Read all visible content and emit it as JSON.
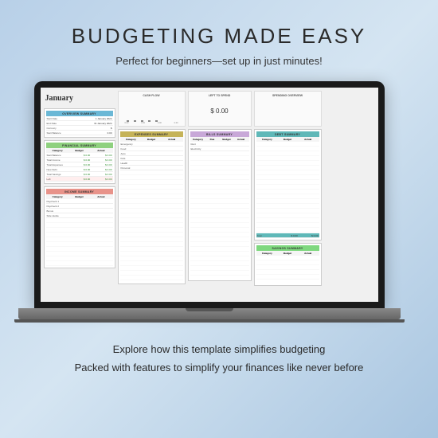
{
  "hero": {
    "title": "BUDGETING MADE EASY",
    "subtitle": "Perfect for beginners—set up in just minutes!"
  },
  "footer": {
    "line1": "Explore how this template simplifies budgeting",
    "line2": "Packed with features to simplify your finances like never before"
  },
  "sheet": {
    "month": "January",
    "overview": {
      "header": "OVERVIEW SUMMARY",
      "rows": [
        [
          "Start Date",
          "1 January 2024"
        ],
        [
          "End Date",
          "31 January 2024"
        ],
        [
          "Currency",
          "$"
        ],
        [
          "Start Balance",
          "0.00"
        ]
      ]
    },
    "financial": {
      "header": "FINANCIAL SUMMARY",
      "cols": [
        "Category",
        "Budget",
        "Actual"
      ],
      "rows": [
        [
          "Start Balance",
          "$ 0.00",
          "$ 0.00"
        ],
        [
          "Total Income",
          "$ 0.00",
          "$ 0.00"
        ],
        [
          "Total Expenses",
          "$ 0.00",
          "$ 0.00"
        ],
        [
          "New Debt",
          "$ 0.00",
          "$ 0.00"
        ],
        [
          "Total Savings",
          "$ 0.00",
          "$ 0.00"
        ]
      ],
      "left": [
        "Left",
        "$ 0.00",
        "$ 0.00"
      ]
    },
    "income": {
      "header": "INCOME SUMMARY",
      "cols": [
        "Category",
        "Budget",
        "Actual"
      ],
      "rows": [
        [
          "Paycheck 1",
          "",
          ""
        ],
        [
          "Paycheck 2",
          "",
          ""
        ],
        [
          "Bonus",
          "",
          ""
        ],
        [
          "Side Hustle",
          "",
          ""
        ]
      ]
    },
    "cashflow": {
      "title": "CASH FLOW",
      "axis": [
        "0.00",
        "0.00",
        "0.00",
        "0.00"
      ],
      "labels": [
        "Income",
        "Expenses",
        "Bills",
        "Debt",
        "Savings"
      ]
    },
    "lefttospend": {
      "title": "LEFT TO SPEND",
      "value": "$ 0.00"
    },
    "spending": {
      "title": "SPENDING OVERVIEW"
    },
    "expenses": {
      "header": "EXPENSES SUMMARY",
      "cols": [
        "Category",
        "Budget",
        "Actual"
      ],
      "rows": [
        [
          "Emergency",
          "",
          ""
        ],
        [
          "Food",
          "",
          ""
        ],
        [
          "Auto",
          "",
          ""
        ],
        [
          "Kids",
          "",
          ""
        ],
        [
          "Health",
          "",
          ""
        ],
        [
          "Personal",
          "",
          ""
        ]
      ]
    },
    "bills": {
      "header": "BILLS SUMMARY",
      "cols": [
        "Category",
        "Due",
        "Budget",
        "Actual"
      ],
      "rows": [
        [
          "Rent",
          "",
          "",
          ""
        ],
        [
          "Electricity",
          "",
          "",
          ""
        ]
      ]
    },
    "debt": {
      "header": "DEBT SUMMARY",
      "cols": [
        "Category",
        "Budget",
        "Actual"
      ],
      "total": [
        "Total",
        "$ 0.00",
        "$ 0.00"
      ]
    },
    "savings": {
      "header": "SAVINGS SUMMARY",
      "cols": [
        "Category",
        "Budget",
        "Actual"
      ]
    }
  }
}
